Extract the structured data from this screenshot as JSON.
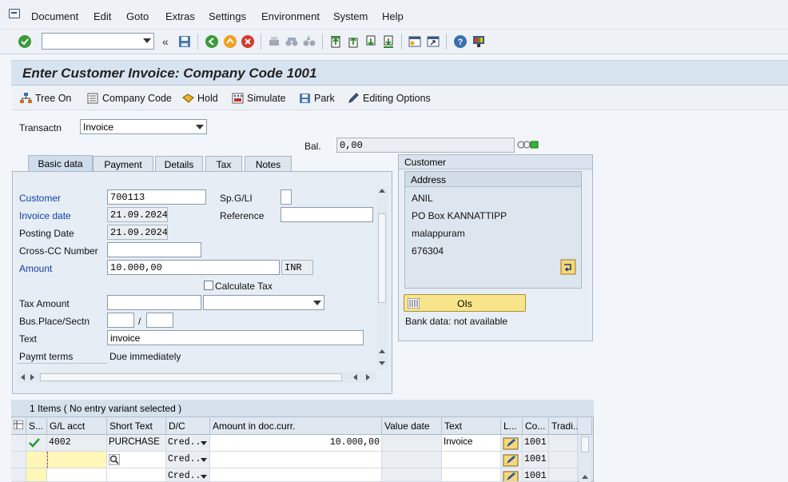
{
  "menu": [
    "Document",
    "Edit",
    "Goto",
    "Extras",
    "Settings",
    "Environment",
    "System",
    "Help"
  ],
  "title": "Enter Customer Invoice: Company Code 1001",
  "app_toolbar": {
    "tree_on": "Tree On",
    "company_code": "Company Code",
    "hold": "Hold",
    "simulate": "Simulate",
    "park": "Park",
    "editing_options": "Editing Options"
  },
  "transaction": {
    "label": "Transactn",
    "value": "Invoice"
  },
  "balance": {
    "label": "Bal.",
    "value": "0,00"
  },
  "tabs": [
    "Basic data",
    "Payment",
    "Details",
    "Tax",
    "Notes"
  ],
  "basic_data": {
    "customer_label": "Customer",
    "customer_value": "700113",
    "spgl_label": "Sp.G/LI",
    "spgl_value": "",
    "invoice_date_label": "Invoice date",
    "invoice_date_value": "21.09.2024",
    "reference_label": "Reference",
    "reference_value": "",
    "posting_date_label": "Posting Date",
    "posting_date_value": "21.09.2024",
    "cross_cc_label": "Cross-CC Number",
    "cross_cc_value": "",
    "amount_label": "Amount",
    "amount_value": "10.000,00",
    "currency": "INR",
    "calc_tax_label": "Calculate Tax",
    "tax_amount_label": "Tax Amount",
    "bus_place_label": "Bus.Place/Sectn",
    "bus_sep": "/",
    "text_label": "Text",
    "text_value": "invoice",
    "paymt_terms_label": "Paymt terms",
    "paymt_terms_value": "Due immediately"
  },
  "customer_panel": {
    "header": "Customer",
    "address_header": "Address",
    "address": [
      "ANIL",
      "PO Box KANNATTIPP",
      "malappuram",
      "676304"
    ],
    "ois_button": "OIs",
    "bank_data": "Bank data: not available"
  },
  "grid": {
    "title": "1 Items ( No entry variant selected )",
    "headers": [
      "S...",
      "G/L acct",
      "Short Text",
      "D/C",
      "Amount in doc.curr.",
      "Value date",
      "Text",
      "L...",
      "Co...",
      "Tradi..."
    ],
    "rows": [
      {
        "gl": "4002",
        "short_text": "PURCHASE",
        "dc": "Cred...",
        "amount": "10.000,00",
        "value_date": "",
        "text": "Invoice",
        "co": "1001"
      },
      {
        "gl": "",
        "short_text": "",
        "dc": "Cred...",
        "amount": "",
        "value_date": "",
        "text": "",
        "co": "1001"
      },
      {
        "gl": "",
        "short_text": "",
        "dc": "Cred...",
        "amount": "",
        "value_date": "",
        "text": "",
        "co": "1001"
      }
    ]
  },
  "colors": {
    "title_bg": "#d7e3ee",
    "required_label": "#1040b0",
    "ois_button": "#f8e58a",
    "status_green": "#2eb82e"
  }
}
